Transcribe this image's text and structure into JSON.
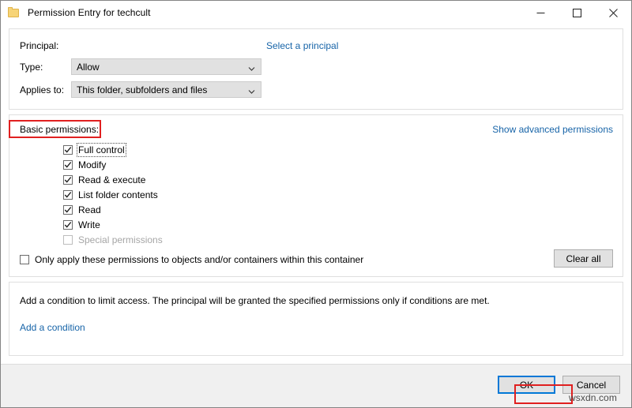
{
  "window": {
    "title": "Permission Entry for techcult",
    "icon": "folder-icon",
    "controls": {
      "minimize": "minimize-icon",
      "maximize": "maximize-icon",
      "close": "close-icon"
    }
  },
  "principal_section": {
    "principal_label": "Principal:",
    "select_principal_link": "Select a principal",
    "type_label": "Type:",
    "type_value": "Allow",
    "applies_to_label": "Applies to:",
    "applies_to_value": "This folder, subfolders and files"
  },
  "permissions_section": {
    "heading": "Basic permissions:",
    "advanced_link": "Show advanced permissions",
    "items": [
      {
        "label": "Full control",
        "checked": true,
        "disabled": false,
        "focused": true
      },
      {
        "label": "Modify",
        "checked": true,
        "disabled": false,
        "focused": false
      },
      {
        "label": "Read & execute",
        "checked": true,
        "disabled": false,
        "focused": false
      },
      {
        "label": "List folder contents",
        "checked": true,
        "disabled": false,
        "focused": false
      },
      {
        "label": "Read",
        "checked": true,
        "disabled": false,
        "focused": false
      },
      {
        "label": "Write",
        "checked": true,
        "disabled": false,
        "focused": false
      },
      {
        "label": "Special permissions",
        "checked": false,
        "disabled": true,
        "focused": false
      }
    ],
    "only_apply_label": "Only apply these permissions to objects and/or containers within this container",
    "only_apply_checked": false,
    "clear_all_label": "Clear all"
  },
  "condition_section": {
    "description": "Add a condition to limit access. The principal will be granted the specified permissions only if conditions are met.",
    "add_condition_link": "Add a condition"
  },
  "footer": {
    "ok_label": "OK",
    "cancel_label": "Cancel"
  },
  "watermark": "wsxdn.com",
  "colors": {
    "link": "#1764a8",
    "annotation": "#e02020",
    "focus": "#0078d7",
    "footer_bg": "#f0f0f0",
    "combo_bg": "#e1e1e1"
  }
}
